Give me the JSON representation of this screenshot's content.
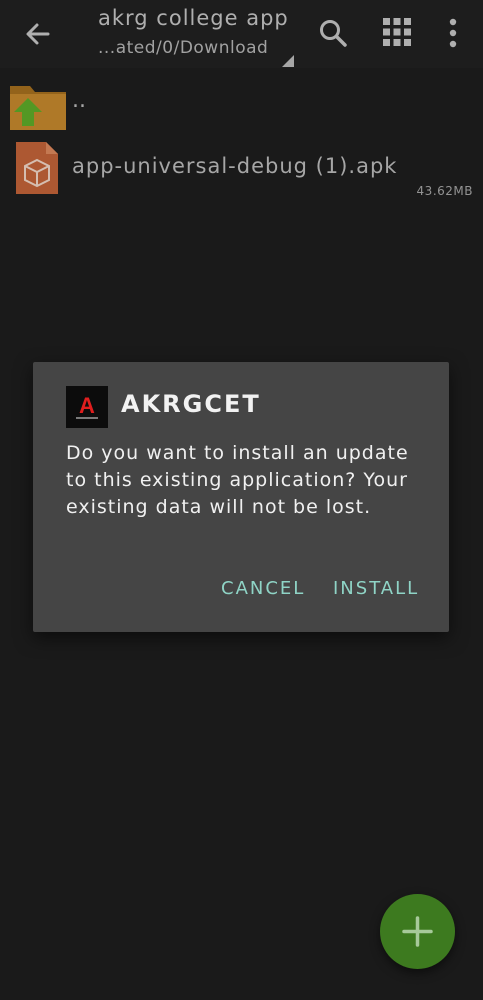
{
  "appbar": {
    "title": "akrg college app",
    "subtitle": "...ated/0/Download"
  },
  "icons": {
    "back": "arrow-back-icon",
    "search": "search-icon",
    "grid": "grid-view-icon",
    "more": "more-vert-icon",
    "folder_up": "folder-up-icon",
    "apk": "apk-package-icon",
    "add": "add-icon"
  },
  "files": [
    {
      "name": "..",
      "size": ""
    },
    {
      "name": "app-universal-debug (1).apk",
      "size": "43.62MB"
    }
  ],
  "dialog": {
    "title": "AKRGCET",
    "message": "Do you want to install an update to this existing application? Your existing data will not be lost.",
    "cancel_label": "CANCEL",
    "install_label": "INSTALL",
    "logo_letter": "A"
  },
  "colors": {
    "background": "#1e1e1e",
    "dialog": "#454545",
    "accent": "#8fd4c6",
    "fab": "#3d7a1f",
    "folder": "#c88a2e",
    "apk": "#c5653a"
  }
}
